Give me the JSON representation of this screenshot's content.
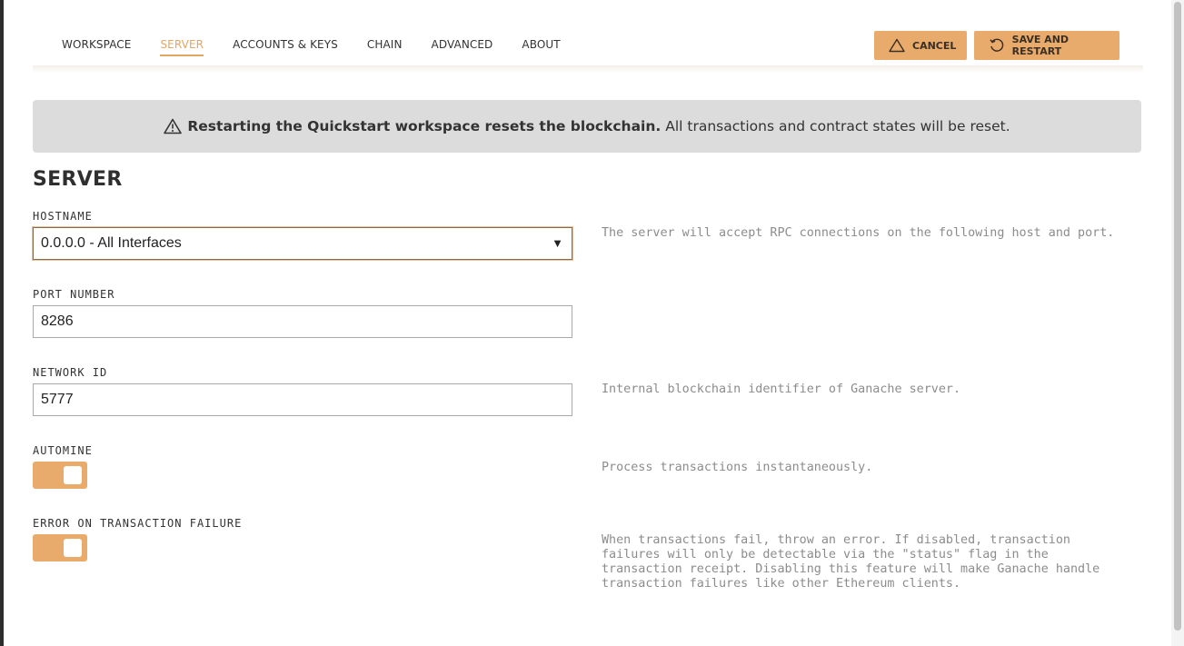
{
  "nav": {
    "tabs": [
      {
        "label": "WORKSPACE"
      },
      {
        "label": "SERVER"
      },
      {
        "label": "ACCOUNTS & KEYS"
      },
      {
        "label": "CHAIN"
      },
      {
        "label": "ADVANCED"
      },
      {
        "label": "ABOUT"
      }
    ],
    "active_tab": "SERVER",
    "cancel_label": "CANCEL",
    "save_label": "SAVE AND RESTART"
  },
  "banner": {
    "bold_text": "Restarting the Quickstart workspace resets the blockchain.",
    "text": "All transactions and contract states will be reset."
  },
  "section": {
    "title": "SERVER",
    "hostname": {
      "label": "HOSTNAME",
      "value": "0.0.0.0 - All Interfaces",
      "description": "The server will accept RPC connections on the following host and port."
    },
    "port": {
      "label": "PORT NUMBER",
      "value": "8286"
    },
    "network_id": {
      "label": "NETWORK ID",
      "value": "5777",
      "description": "Internal blockchain identifier of Ganache server."
    },
    "automine": {
      "label": "AUTOMINE",
      "enabled": true,
      "description": "Process transactions instantaneously."
    },
    "error_on_failure": {
      "label": "ERROR ON TRANSACTION FAILURE",
      "enabled": true,
      "description_lines": [
        "When transactions fail, throw an error. If disabled, transaction",
        "failures will only be detectable via the \"status\" flag in the",
        "transaction receipt. Disabling this feature will make Ganache handle",
        "transaction failures like other Ethereum clients."
      ]
    }
  },
  "colors": {
    "accent": "#e9ab6b",
    "active_tab": "#e4a663",
    "banner_bg": "#dcdcdc"
  }
}
